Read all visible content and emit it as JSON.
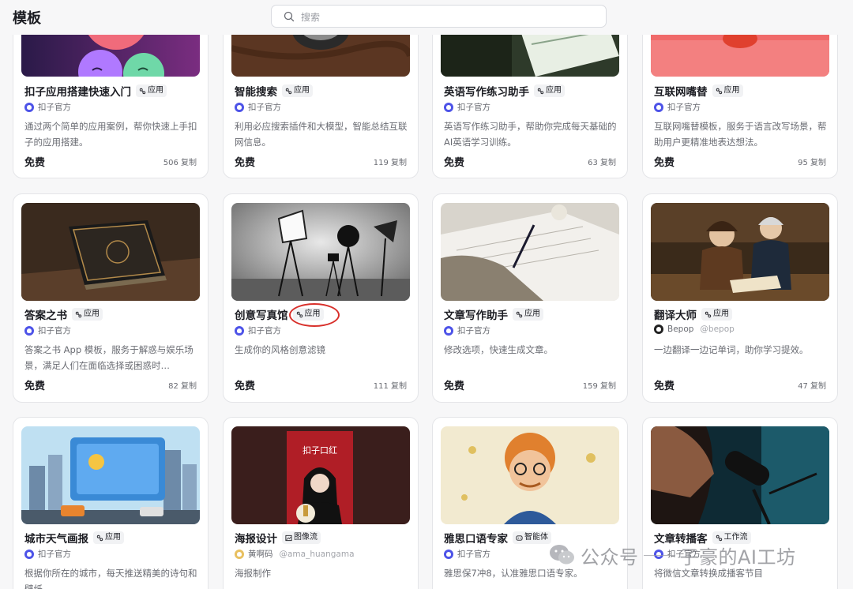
{
  "header": {
    "title": "模板",
    "search_placeholder": "搜索"
  },
  "cards": [
    {
      "title": "扣子应用搭建快速入门",
      "tag": "应用",
      "author": "扣子官方",
      "handle": "",
      "desc": "通过两个简单的应用案例，帮你快速上手扣子的应用搭建。",
      "price": "免费",
      "copies": "506 复制"
    },
    {
      "title": "智能搜索",
      "tag": "应用",
      "author": "扣子官方",
      "handle": "",
      "desc": "利用必应搜索插件和大模型，智能总结互联网信息。",
      "price": "免费",
      "copies": "119 复制"
    },
    {
      "title": "英语写作练习助手",
      "tag": "应用",
      "author": "扣子官方",
      "handle": "",
      "desc": "英语写作练习助手，帮助你完成每天基础的AI英语学习训练。",
      "price": "免费",
      "copies": "63 复制"
    },
    {
      "title": "互联网嘴替",
      "tag": "应用",
      "author": "扣子官方",
      "handle": "",
      "desc": "互联网嘴替模板，服务于语言改写场景，帮助用户更精准地表达想法。",
      "price": "免费",
      "copies": "95 复制"
    },
    {
      "title": "答案之书",
      "tag": "应用",
      "author": "扣子官方",
      "handle": "",
      "desc": "答案之书 App 模板，服务于解惑与娱乐场景，满足人们在面临选择或困惑时…",
      "price": "免费",
      "copies": "82 复制"
    },
    {
      "title": "创意写真馆",
      "tag": "应用",
      "author": "扣子官方",
      "handle": "",
      "desc": "生成你的风格创意滤镜",
      "price": "免费",
      "copies": "111 复制"
    },
    {
      "title": "文章写作助手",
      "tag": "应用",
      "author": "扣子官方",
      "handle": "",
      "desc": "修改选项，快速生成文章。",
      "price": "免费",
      "copies": "159 复制"
    },
    {
      "title": "翻译大师",
      "tag": "应用",
      "author": "Bepop",
      "handle": "@bepop",
      "desc": "一边翻译一边记单词，助你学习提效。",
      "price": "免费",
      "copies": "47 复制"
    },
    {
      "title": "城市天气画报",
      "tag": "应用",
      "author": "扣子官方",
      "handle": "",
      "desc": "根据你所在的城市，每天推送精美的诗句和壁纸",
      "price": "",
      "copies": ""
    },
    {
      "title": "海报设计",
      "tag": "图像流",
      "author": "黄啊码",
      "handle": "@ama_huangama",
      "desc": "海报制作",
      "price": "",
      "copies": ""
    },
    {
      "title": "雅思口语专家",
      "tag": "智能体",
      "author": "扣子官方",
      "handle": "",
      "desc": "雅思保7冲8，认准雅思口语专家。",
      "price": "",
      "copies": ""
    },
    {
      "title": "文章转播客",
      "tag": "工作流",
      "author": "扣子官方",
      "handle": "",
      "desc": "将微信文章转换成播客节目",
      "price": "",
      "copies": ""
    }
  ],
  "poster_text": "扣子口红",
  "watermark": {
    "left": "公众号",
    "right": "子豪的AI工坊"
  }
}
